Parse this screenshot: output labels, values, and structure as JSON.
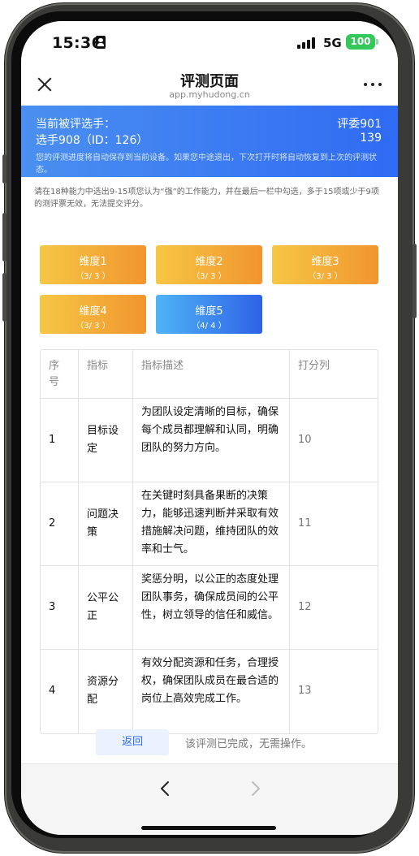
{
  "status_bar": {
    "time": "15:36",
    "network": "5G",
    "battery": "100"
  },
  "nav": {
    "title": "评测页面",
    "url": "app.myhudong.cn"
  },
  "banner": {
    "label": "当前被评选手：",
    "candidate": "选手908（ID：126）",
    "judge": "评委901",
    "number": "139",
    "note": "您的评测进度将自动保存到当前设备。如果您中途退出，下次打开时将自动恢复到上次的评测状态。"
  },
  "instructions": "请在18种能力中选出9-15项您认为“强”的工作能力，并在最后一栏中勾选，多于15项或少于9项的测评票无效，无法提交评分。",
  "dimensions": [
    {
      "name": "维度1",
      "count": "（3/ 3 ）",
      "active": false
    },
    {
      "name": "维度2",
      "count": "（3/ 3 ）",
      "active": false
    },
    {
      "name": "维度3",
      "count": "（3/ 3 ）",
      "active": false
    },
    {
      "name": "维度4",
      "count": "（3/ 3 ）",
      "active": false
    },
    {
      "name": "维度5",
      "count": "（4/ 4 ）",
      "active": true
    }
  ],
  "table": {
    "headers": [
      "序号",
      "指标",
      "指标描述",
      "打分列"
    ],
    "rows": [
      {
        "no": "1",
        "indicator": "目标设定",
        "description": "为团队设定清晰的目标，确保每个成员都理解和认同，明确团队的努力方向。",
        "score_placeholder": "10"
      },
      {
        "no": "2",
        "indicator": "问题决策",
        "description": "在关键时刻具备果断的决策力，能够迅速判断并采取有效措施解决问题，维持团队的效率和士气。",
        "score_placeholder": "11"
      },
      {
        "no": "3",
        "indicator": "公平公正",
        "description": "奖惩分明，以公正的态度处理团队事务，确保成员间的公平性，树立领导的信任和威信。",
        "score_placeholder": "12"
      },
      {
        "no": "4",
        "indicator": "资源分配",
        "description": "有效分配资源和任务，合理授权，确保团队成员在最合适的岗位上高效完成工作。",
        "score_placeholder": "13"
      }
    ]
  },
  "footer": {
    "back_label": "返回",
    "done_text": "该评测已完成，无需操作。"
  },
  "colors": {
    "primary": "#2f6bf3",
    "dimension_gradient_start": "#f6c744",
    "dimension_gradient_end": "#f1952e",
    "active_gradient_start": "#4fb4f6",
    "active_gradient_end": "#2e62e6"
  }
}
